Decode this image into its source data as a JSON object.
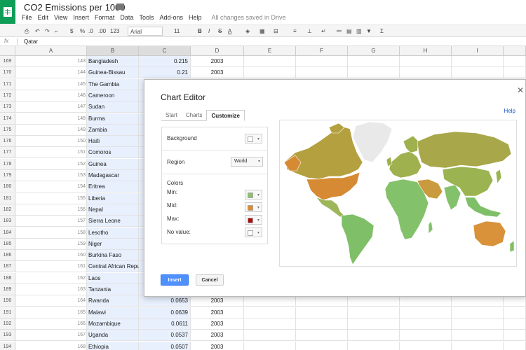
{
  "header": {
    "title": "CO2 Emissions per 1000",
    "menu": [
      "File",
      "Edit",
      "View",
      "Insert",
      "Format",
      "Data",
      "Tools",
      "Add-ons",
      "Help"
    ],
    "save_status": "All changes saved in Drive"
  },
  "toolbar": {
    "percent": "%",
    "decimal_dec": ".0",
    "decimal_inc": ".00",
    "format_123": "123",
    "font": "Arial",
    "font_size": "11",
    "bold": "B",
    "italic": "I",
    "strike": "S",
    "text_color": "A",
    "sigma": "Σ"
  },
  "formula_bar": {
    "fx": "fx",
    "value": "Qatar"
  },
  "columns": [
    "A",
    "B",
    "C",
    "D",
    "E",
    "F",
    "G",
    "H",
    "I"
  ],
  "rows": [
    {
      "num": "169",
      "idx": "143",
      "country": "Bangladesh",
      "value": "0.215",
      "year": "2003"
    },
    {
      "num": "170",
      "idx": "144",
      "country": "Guinea-Bissau",
      "value": "0.21",
      "year": "2003"
    },
    {
      "num": "171",
      "idx": "145",
      "country": "The Gambia",
      "value": "",
      "year": ""
    },
    {
      "num": "172",
      "idx": "146",
      "country": "Cameroon",
      "value": "",
      "year": ""
    },
    {
      "num": "173",
      "idx": "147",
      "country": "Sudan",
      "value": "",
      "year": ""
    },
    {
      "num": "174",
      "idx": "148",
      "country": "Burma",
      "value": "",
      "year": ""
    },
    {
      "num": "175",
      "idx": "149",
      "country": "Zambia",
      "value": "",
      "year": ""
    },
    {
      "num": "176",
      "idx": "150",
      "country": "Haiti",
      "value": "",
      "year": ""
    },
    {
      "num": "177",
      "idx": "151",
      "country": "Comoros",
      "value": "",
      "year": ""
    },
    {
      "num": "178",
      "idx": "152",
      "country": "Guinea",
      "value": "",
      "year": ""
    },
    {
      "num": "179",
      "idx": "153",
      "country": "Madagascar",
      "value": "",
      "year": ""
    },
    {
      "num": "180",
      "idx": "154",
      "country": "Eritrea",
      "value": "",
      "year": ""
    },
    {
      "num": "181",
      "idx": "155",
      "country": "Liberia",
      "value": "",
      "year": ""
    },
    {
      "num": "182",
      "idx": "156",
      "country": "Nepal",
      "value": "",
      "year": ""
    },
    {
      "num": "183",
      "idx": "157",
      "country": "Sierra Leone",
      "value": "",
      "year": ""
    },
    {
      "num": "184",
      "idx": "158",
      "country": "Lesotho",
      "value": "",
      "year": ""
    },
    {
      "num": "185",
      "idx": "159",
      "country": "Niger",
      "value": "",
      "year": ""
    },
    {
      "num": "186",
      "idx": "160",
      "country": "Burkina Faso",
      "value": "",
      "year": ""
    },
    {
      "num": "187",
      "idx": "161",
      "country": "Central African Repu",
      "value": "",
      "year": ""
    },
    {
      "num": "188",
      "idx": "162",
      "country": "Laos",
      "value": "",
      "year": ""
    },
    {
      "num": "189",
      "idx": "163",
      "country": "Tanzania",
      "value": "",
      "year": ""
    },
    {
      "num": "190",
      "idx": "164",
      "country": "Rwanda",
      "value": "0.0653",
      "year": "2003"
    },
    {
      "num": "191",
      "idx": "165",
      "country": "Malawi",
      "value": "0.0639",
      "year": "2003"
    },
    {
      "num": "192",
      "idx": "166",
      "country": "Mozambique",
      "value": "0.0611",
      "year": "2003"
    },
    {
      "num": "193",
      "idx": "167",
      "country": "Uganda",
      "value": "0.0537",
      "year": "2003"
    },
    {
      "num": "194",
      "idx": "168",
      "country": "Ethiopia",
      "value": "0.0507",
      "year": "2003"
    }
  ],
  "dialog": {
    "title": "Chart Editor",
    "help": "Help",
    "tabs": [
      "Start",
      "Charts",
      "Customize"
    ],
    "active_tab": "Customize",
    "background_label": "Background",
    "region_label": "Region",
    "region_value": "World",
    "colors_heading": "Colors",
    "min_label": "Min:",
    "mid_label": "Mid:",
    "max_label": "Max:",
    "novalue_label": "No value:",
    "swatches": {
      "background": "#ffffff",
      "min": "#8bc06f",
      "mid": "#e08a2c",
      "max": "#a50f0f",
      "novalue": "#ffffff"
    },
    "insert_label": "Insert",
    "cancel_label": "Cancel"
  },
  "map_colors": {
    "greenland": "#e9e9e9",
    "north_america": "#b4a03e",
    "usa": "#d68a34",
    "central_america": "#9db659",
    "south_america": "#7fbf67",
    "europe": "#9fb04e",
    "russia": "#a8a74a",
    "middle_east": "#c99a3e",
    "africa": "#83c16a",
    "asia": "#9bb451",
    "australia": "#d9913a"
  }
}
